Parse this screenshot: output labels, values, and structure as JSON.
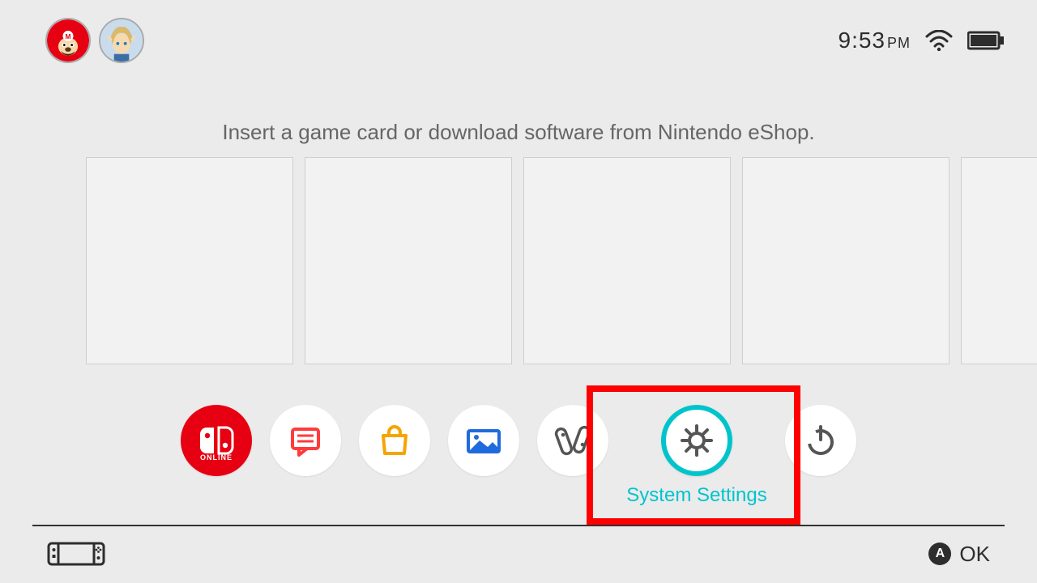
{
  "header": {
    "avatars": [
      {
        "name": "mario"
      },
      {
        "name": "link"
      }
    ],
    "time": "9:53",
    "ampm": "PM"
  },
  "hint": "Insert a game card or download software from Nintendo eShop.",
  "tiles_count": 5,
  "dock": {
    "items": [
      {
        "id": "online",
        "label": "Nintendo Switch Online",
        "sublabel": "ONLINE"
      },
      {
        "id": "news",
        "label": "News"
      },
      {
        "id": "eshop",
        "label": "Nintendo eShop"
      },
      {
        "id": "album",
        "label": "Album"
      },
      {
        "id": "controllers",
        "label": "Controllers"
      },
      {
        "id": "settings",
        "label": "System Settings"
      },
      {
        "id": "sleep",
        "label": "Sleep Mode"
      }
    ],
    "selected_index": 5,
    "selected_label": "System Settings"
  },
  "footer": {
    "ok_btn": "A",
    "ok_label": "OK"
  },
  "colors": {
    "accent": "#00c4cc",
    "highlight": "#ff0000",
    "online_red": "#e60012"
  }
}
